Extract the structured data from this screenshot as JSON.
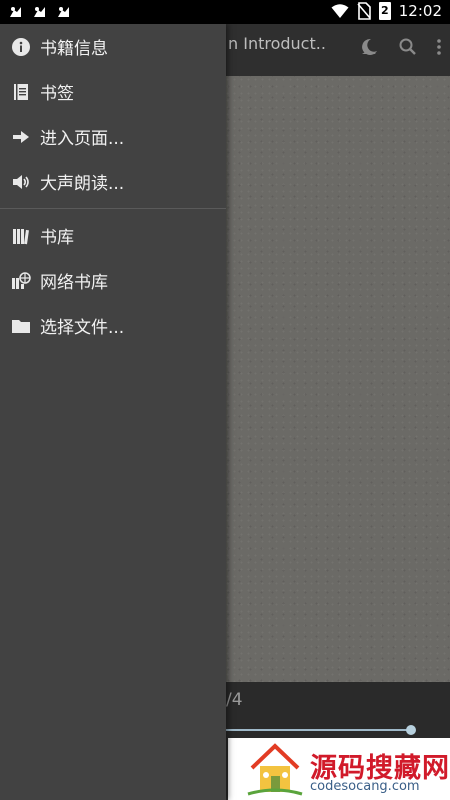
{
  "status_bar": {
    "time": "12:02",
    "battery": "2",
    "left_icons": [
      "notification-app-icon",
      "notification-app-icon",
      "notification-app-icon"
    ]
  },
  "app_bar": {
    "title": "n Introduct..."
  },
  "reader": {
    "page_indicator": "/4",
    "progress_fraction": 0.96
  },
  "drawer": {
    "group1": [
      {
        "label": "书籍信息",
        "icon": "info-icon"
      },
      {
        "label": "书签",
        "icon": "bookmark-icon"
      },
      {
        "label": "进入页面...",
        "icon": "arrow-right-icon"
      },
      {
        "label": "大声朗读...",
        "icon": "speaker-icon"
      }
    ],
    "group2": [
      {
        "label": "书库",
        "icon": "library-icon"
      },
      {
        "label": "网络书库",
        "icon": "network-library-icon"
      },
      {
        "label": "选择文件...",
        "icon": "folder-icon"
      }
    ]
  },
  "watermark": {
    "main": "源码搜藏网",
    "sub": "codesocang.com"
  }
}
